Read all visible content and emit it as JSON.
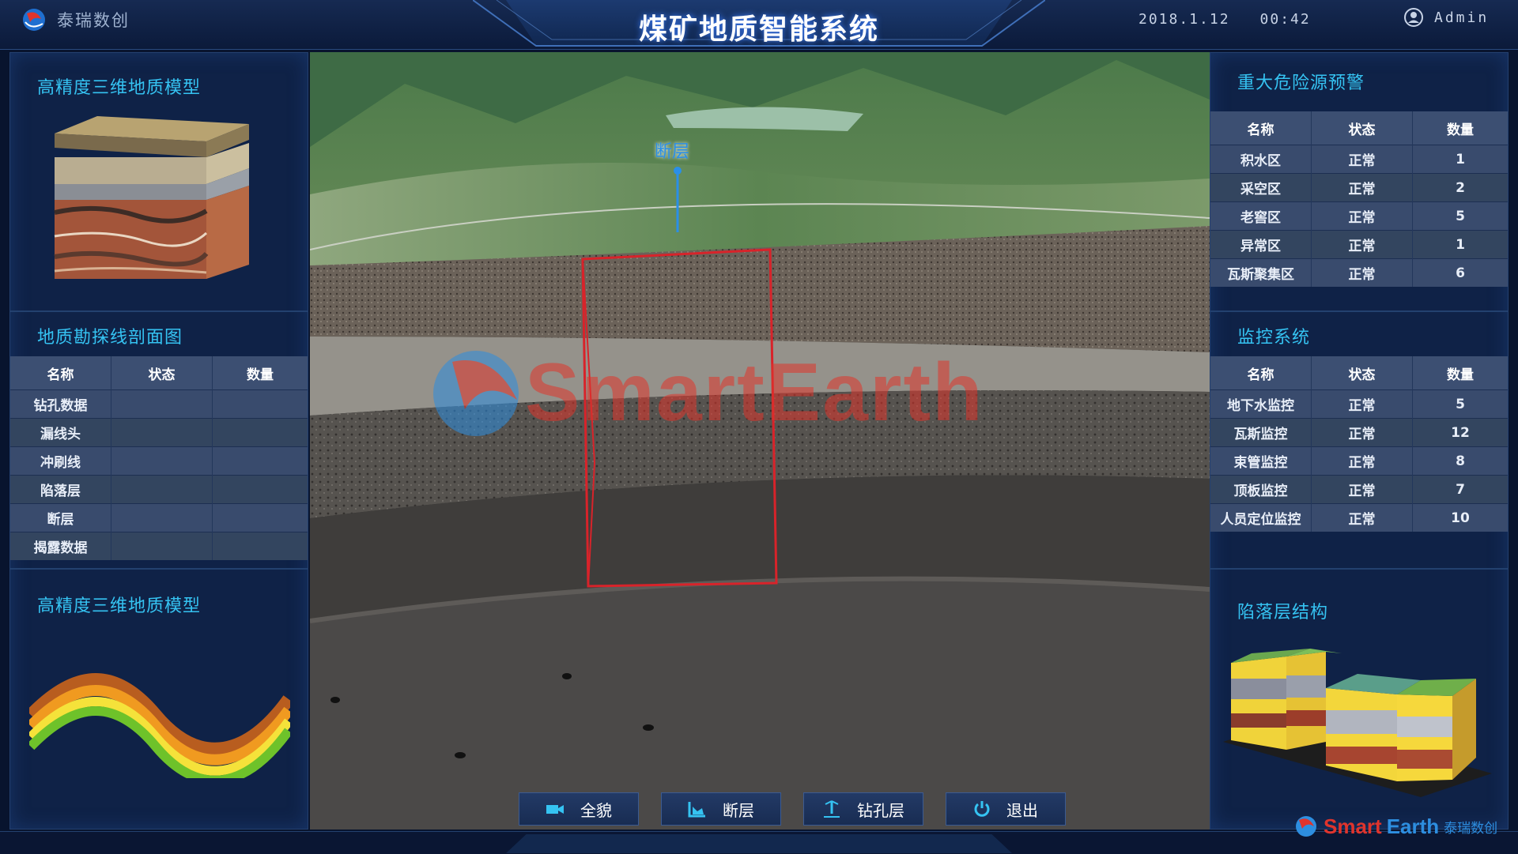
{
  "header": {
    "brand_name": "泰瑞数创",
    "title": "煤矿地质智能系统",
    "date": "2018.1.12",
    "time": "00:42",
    "user": "Admin"
  },
  "left": {
    "model_title": "高精度三维地质模型",
    "section_title": "地质勘探线剖面图",
    "table": {
      "headers": [
        "名称",
        "状态",
        "数量"
      ],
      "rows": [
        [
          "钻孔数据",
          "",
          ""
        ],
        [
          "漏线头",
          "",
          ""
        ],
        [
          "冲刷线",
          "",
          ""
        ],
        [
          "陷落层",
          "",
          ""
        ],
        [
          "断层",
          "",
          ""
        ],
        [
          "揭露数据",
          "",
          ""
        ]
      ]
    },
    "model_title_2": "高精度三维地质模型"
  },
  "right": {
    "hazard_title": "重大危险源预警",
    "hazard_table": {
      "headers": [
        "名称",
        "状态",
        "数量"
      ],
      "rows": [
        [
          "积水区",
          "正常",
          "1"
        ],
        [
          "采空区",
          "正常",
          "2"
        ],
        [
          "老窖区",
          "正常",
          "5"
        ],
        [
          "异常区",
          "正常",
          "1"
        ],
        [
          "瓦斯聚集区",
          "正常",
          "6"
        ]
      ]
    },
    "monitor_title": "监控系统",
    "monitor_table": {
      "headers": [
        "名称",
        "状态",
        "数量"
      ],
      "rows": [
        [
          "地下水监控",
          "正常",
          "5"
        ],
        [
          "瓦斯监控",
          "正常",
          "12"
        ],
        [
          "束管监控",
          "正常",
          "8"
        ],
        [
          "顶板监控",
          "正常",
          "7"
        ],
        [
          "人员定位监控",
          "正常",
          "10"
        ]
      ]
    },
    "collapse_title": "陷落层结构"
  },
  "viewport": {
    "fault_label": "断层",
    "watermark": "SmartEarth"
  },
  "toolbar": {
    "items": [
      {
        "label": "全貌",
        "icon": "camera-icon"
      },
      {
        "label": "断层",
        "icon": "fault-icon"
      },
      {
        "label": "钻孔层",
        "icon": "drill-icon"
      },
      {
        "label": "退出",
        "icon": "power-icon"
      }
    ]
  },
  "footer": {
    "logo_part1": "Smart",
    "logo_part2": "Earth",
    "logo_cn": "泰瑞数创"
  },
  "colors": {
    "accent": "#35c3f2",
    "panel": "#0f2247",
    "fault_box": "#d8232a"
  }
}
